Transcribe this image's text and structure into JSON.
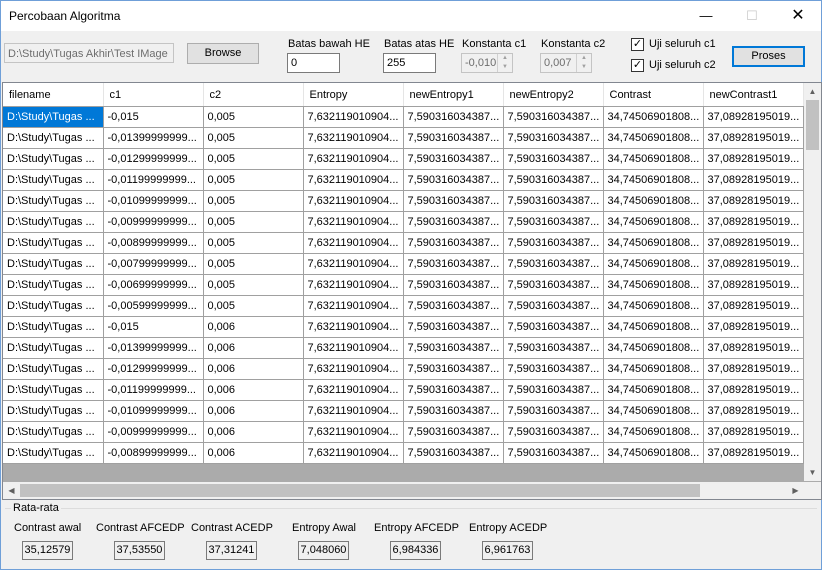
{
  "window": {
    "title": "Percobaan Algoritma",
    "minimize_icon": "minimize-icon",
    "maximize_icon": "maximize-icon",
    "close_icon": "close-icon"
  },
  "toolbar": {
    "path_value": "D:\\Study\\Tugas Akhir\\Test IMage",
    "browse_label": "Browse",
    "batas_bawah_label": "Batas bawah HE",
    "batas_bawah_value": "0",
    "batas_atas_label": "Batas atas HE",
    "batas_atas_value": "255",
    "konstanta_c1_label": "Konstanta c1",
    "konstanta_c1_value": "-0,010",
    "konstanta_c2_label": "Konstanta c2",
    "konstanta_c2_value": "0,007",
    "uji_c1_label": "Uji seluruh c1",
    "uji_c1_checked": true,
    "uji_c2_label": "Uji seluruh c2",
    "uji_c2_checked": true,
    "proses_label": "Proses"
  },
  "grid": {
    "columns": [
      "filename",
      "c1",
      "c2",
      "Entropy",
      "newEntropy1",
      "newEntropy2",
      "Contrast",
      "newContrast1"
    ],
    "rows": [
      [
        "D:\\Study\\Tugas ...",
        "-0,015",
        "0,005",
        "7,632119010904...",
        "7,590316034387...",
        "7,590316034387...",
        "34,74506901808...",
        "37,08928195019..."
      ],
      [
        "D:\\Study\\Tugas ...",
        "-0,01399999999...",
        "0,005",
        "7,632119010904...",
        "7,590316034387...",
        "7,590316034387...",
        "34,74506901808...",
        "37,08928195019..."
      ],
      [
        "D:\\Study\\Tugas ...",
        "-0,01299999999...",
        "0,005",
        "7,632119010904...",
        "7,590316034387...",
        "7,590316034387...",
        "34,74506901808...",
        "37,08928195019..."
      ],
      [
        "D:\\Study\\Tugas ...",
        "-0,01199999999...",
        "0,005",
        "7,632119010904...",
        "7,590316034387...",
        "7,590316034387...",
        "34,74506901808...",
        "37,08928195019..."
      ],
      [
        "D:\\Study\\Tugas ...",
        "-0,01099999999...",
        "0,005",
        "7,632119010904...",
        "7,590316034387...",
        "7,590316034387...",
        "34,74506901808...",
        "37,08928195019..."
      ],
      [
        "D:\\Study\\Tugas ...",
        "-0,00999999999...",
        "0,005",
        "7,632119010904...",
        "7,590316034387...",
        "7,590316034387...",
        "34,74506901808...",
        "37,08928195019..."
      ],
      [
        "D:\\Study\\Tugas ...",
        "-0,00899999999...",
        "0,005",
        "7,632119010904...",
        "7,590316034387...",
        "7,590316034387...",
        "34,74506901808...",
        "37,08928195019..."
      ],
      [
        "D:\\Study\\Tugas ...",
        "-0,00799999999...",
        "0,005",
        "7,632119010904...",
        "7,590316034387...",
        "7,590316034387...",
        "34,74506901808...",
        "37,08928195019..."
      ],
      [
        "D:\\Study\\Tugas ...",
        "-0,00699999999...",
        "0,005",
        "7,632119010904...",
        "7,590316034387...",
        "7,590316034387...",
        "34,74506901808...",
        "37,08928195019..."
      ],
      [
        "D:\\Study\\Tugas ...",
        "-0,00599999999...",
        "0,005",
        "7,632119010904...",
        "7,590316034387...",
        "7,590316034387...",
        "34,74506901808...",
        "37,08928195019..."
      ],
      [
        "D:\\Study\\Tugas ...",
        "-0,015",
        "0,006",
        "7,632119010904...",
        "7,590316034387...",
        "7,590316034387...",
        "34,74506901808...",
        "37,08928195019..."
      ],
      [
        "D:\\Study\\Tugas ...",
        "-0,01399999999...",
        "0,006",
        "7,632119010904...",
        "7,590316034387...",
        "7,590316034387...",
        "34,74506901808...",
        "37,08928195019..."
      ],
      [
        "D:\\Study\\Tugas ...",
        "-0,01299999999...",
        "0,006",
        "7,632119010904...",
        "7,590316034387...",
        "7,590316034387...",
        "34,74506901808...",
        "37,08928195019..."
      ],
      [
        "D:\\Study\\Tugas ...",
        "-0,01199999999...",
        "0,006",
        "7,632119010904...",
        "7,590316034387...",
        "7,590316034387...",
        "34,74506901808...",
        "37,08928195019..."
      ],
      [
        "D:\\Study\\Tugas ...",
        "-0,01099999999...",
        "0,006",
        "7,632119010904...",
        "7,590316034387...",
        "7,590316034387...",
        "34,74506901808...",
        "37,08928195019..."
      ],
      [
        "D:\\Study\\Tugas ...",
        "-0,00999999999...",
        "0,006",
        "7,632119010904...",
        "7,590316034387...",
        "7,590316034387...",
        "34,74506901808...",
        "37,08928195019..."
      ],
      [
        "D:\\Study\\Tugas ...",
        "-0,00899999999...",
        "0,006",
        "7,632119010904...",
        "7,590316034387...",
        "7,590316034387...",
        "34,74506901808...",
        "37,08928195019..."
      ]
    ],
    "selected_row": 0,
    "selected_col": 0
  },
  "stats": {
    "group_label": "Rata-rata",
    "items": [
      {
        "label": "Contrast awal",
        "value": "35,12579"
      },
      {
        "label": "Contrast AFCEDP",
        "value": "37,53550"
      },
      {
        "label": "Contrast ACEDP",
        "value": "37,31241"
      },
      {
        "label": "Entropy Awal",
        "value": "7,048060"
      },
      {
        "label": "Entropy AFCEDP",
        "value": "6,984336"
      },
      {
        "label": "Entropy ACEDP",
        "value": "6,961763"
      }
    ]
  },
  "colors": {
    "selection": "#0078d7",
    "window_border": "#6f9fd8",
    "default_button_border": "#0078d7"
  }
}
